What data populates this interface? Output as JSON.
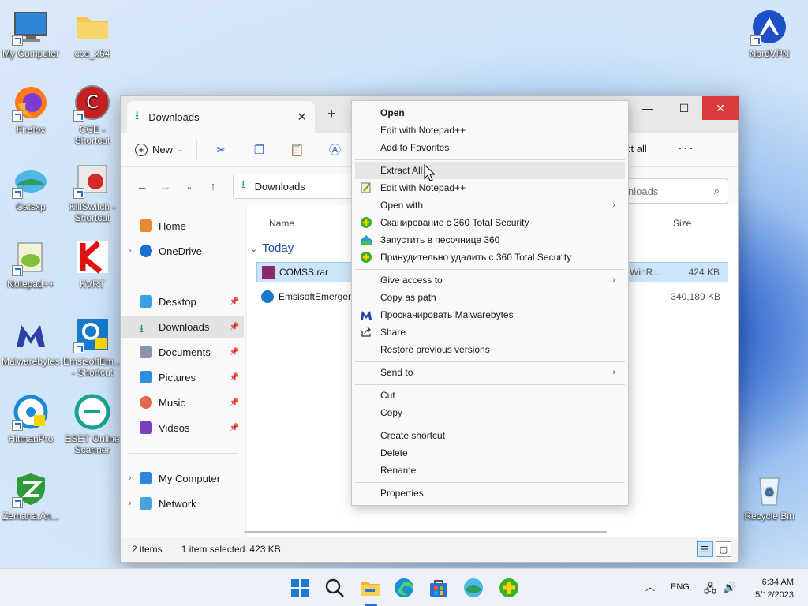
{
  "desktop": {
    "icons": [
      {
        "label": "My Computer"
      },
      {
        "label": "cce_x64"
      },
      {
        "label": "Firefox"
      },
      {
        "label": "CCE -\nShortcut"
      },
      {
        "label": "Catsxp"
      },
      {
        "label": "KillSwitch -\nShortcut"
      },
      {
        "label": "Notepad++"
      },
      {
        "label": "KVRT"
      },
      {
        "label": "Malwarebytes"
      },
      {
        "label": "EmsisoftEm...\n- Shortcut"
      },
      {
        "label": "HitmanPro"
      },
      {
        "label": "ESET Online\nScanner"
      },
      {
        "label": "Zemana.An..."
      },
      {
        "label": "NordVPN"
      },
      {
        "label": "Recycle Bin"
      }
    ]
  },
  "explorer": {
    "tab_title": "Downloads",
    "new_label": "New",
    "select_all_partial": "ct all",
    "address": "Downloads",
    "search_placeholder": "nloads",
    "sidebar": {
      "home": "Home",
      "onedrive": "OneDrive",
      "desktop": "Desktop",
      "downloads": "Downloads",
      "documents": "Documents",
      "pictures": "Pictures",
      "music": "Music",
      "videos": "Videos",
      "mycomputer": "My Computer",
      "network": "Network"
    },
    "columns": {
      "name": "Name",
      "size": "Size"
    },
    "group": "Today",
    "files": [
      {
        "name": "COMSS.rar",
        "type": "WinR...",
        "size": "424 KB"
      },
      {
        "name": "EmsisoftEmergenc",
        "type": "",
        "size": "340,189 KB"
      }
    ],
    "status": {
      "items": "2 items",
      "selected": "1 item selected",
      "size": "423 KB"
    }
  },
  "context_menu": {
    "open": "Open",
    "edit_npp": "Edit with Notepad++",
    "add_fav": "Add to Favorites",
    "extract_all": "Extract All",
    "edit_npp2": "Edit with Notepad++",
    "open_with": "Open with",
    "scan360": "Сканирование с 360 Total Security",
    "sandbox360": "Запустить в песочнице 360",
    "delete360": "Принудительно удалить с  360 Total Security",
    "give_access": "Give access to",
    "copy_path": "Copy as path",
    "malwarebytes": "Просканировать Malwarebytes",
    "share": "Share",
    "restore": "Restore previous versions",
    "send_to": "Send to",
    "cut": "Cut",
    "copy": "Copy",
    "create_shortcut": "Create shortcut",
    "delete": "Delete",
    "rename": "Rename",
    "properties": "Properties"
  },
  "taskbar": {
    "lang": "ENG",
    "time": "6:34 AM",
    "date": "5/12/2023"
  }
}
